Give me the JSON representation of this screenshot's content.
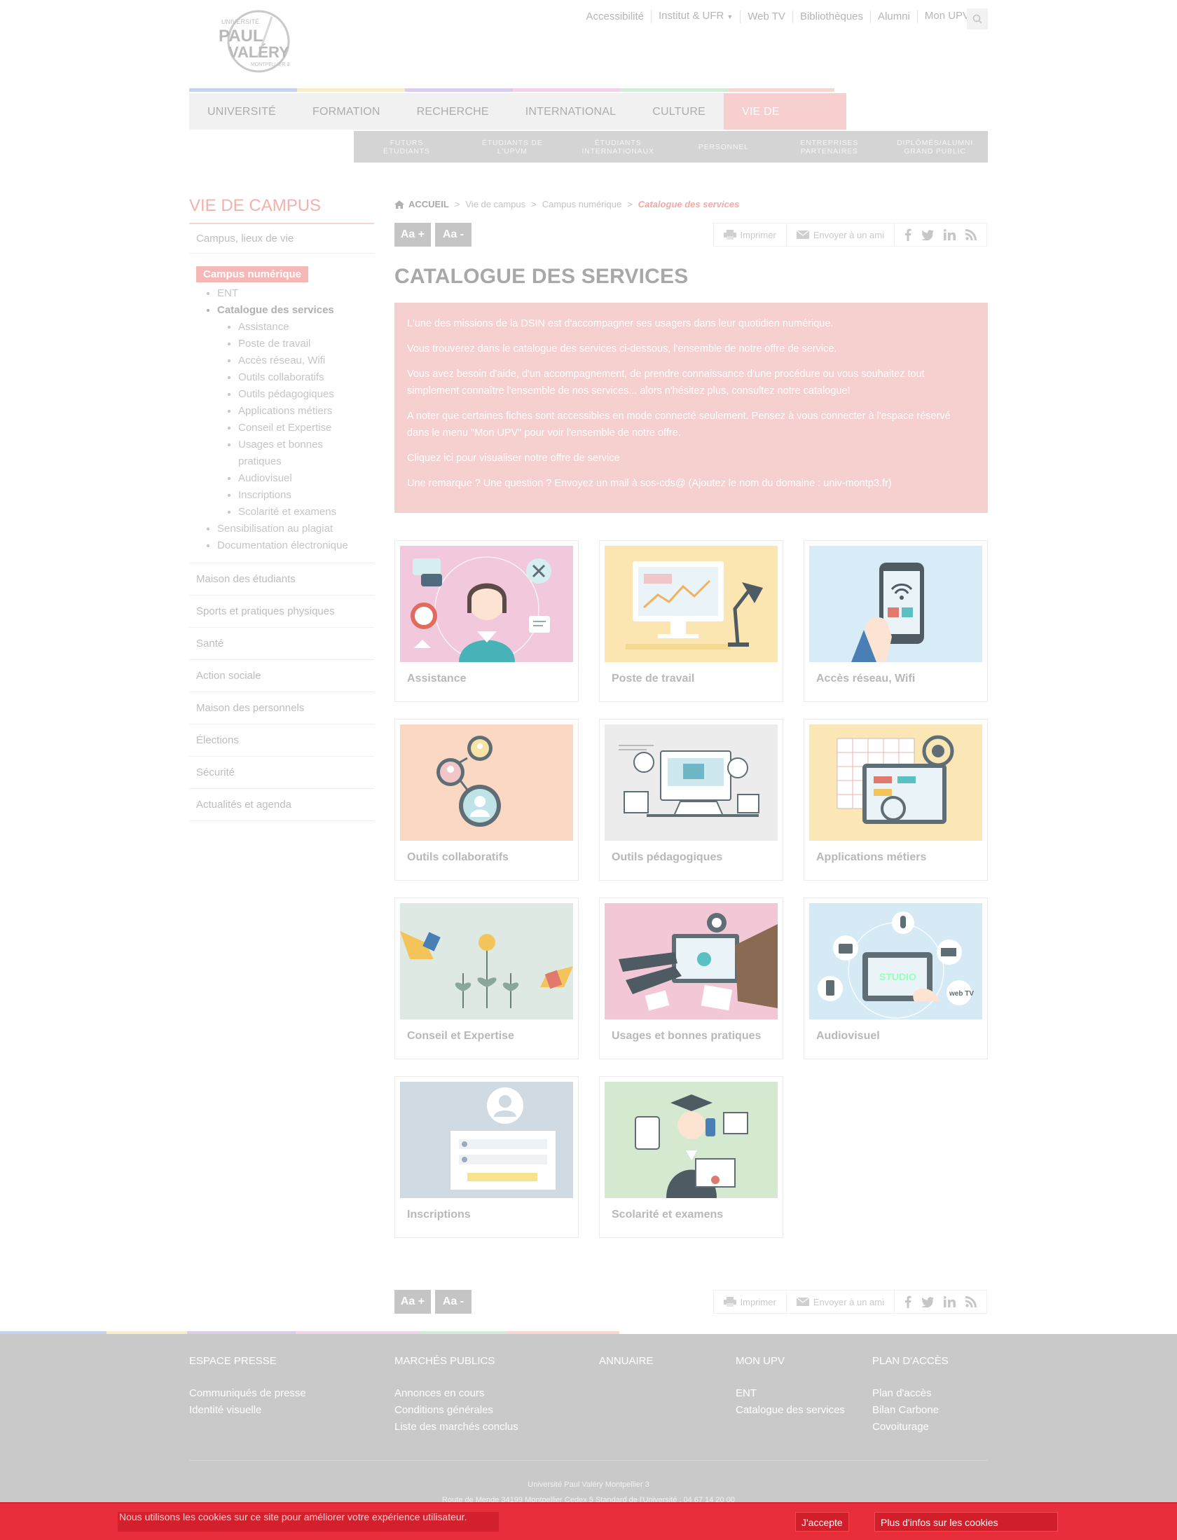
{
  "header": {
    "logo": {
      "line1": "UNIVERSITÉ",
      "line2": "PAUL",
      "line3": "VALÉRY",
      "line4": "MONTPELLIER 3"
    },
    "topnav": [
      {
        "label": "Accessibilité",
        "caret": false
      },
      {
        "label": "Institut & UFR",
        "caret": true
      },
      {
        "label": "Web TV",
        "caret": false
      },
      {
        "label": "Bibliothèques",
        "caret": false
      },
      {
        "label": "Alumni",
        "caret": false
      },
      {
        "label": "Mon UPV",
        "caret": true
      }
    ],
    "mainnav": [
      "Université",
      "Formation",
      "Recherche",
      "International",
      "Culture",
      "Vie de campus"
    ],
    "mainnav_active": "Vie de campus",
    "subnav": [
      {
        "l1": "Futurs",
        "l2": "étudiants"
      },
      {
        "l1": "Étudiants de",
        "l2": "l'UPVM"
      },
      {
        "l1": "Étudiants",
        "l2": "internationaux"
      },
      {
        "l1": "Personnel",
        "l2": ""
      },
      {
        "l1": "Entreprises",
        "l2": "partenaires"
      },
      {
        "l1": "Diplômés/Alumni",
        "l2": "Grand public"
      }
    ],
    "colors": {
      "accent": "#f7cfcf",
      "bar": [
        "#c6d3ec",
        "#f7edc8",
        "#d9cdec",
        "#f3d3e7",
        "#d1ecd8",
        "#f6d7d2"
      ]
    }
  },
  "sidebar": {
    "title": "VIE DE CAMPUS",
    "link_first": "Campus, lieux de vie",
    "active": "Campus numérique",
    "tree": {
      "items_top": [
        "ENT"
      ],
      "current": "Catalogue des services",
      "children": [
        "Assistance",
        "Poste de travail",
        "Accès réseau, Wifi",
        "Outils collaboratifs",
        "Outils pédagogiques",
        "Applications métiers",
        "Conseil et Expertise",
        "Usages et bonnes pratiques",
        "Audiovisuel",
        "Inscriptions",
        "Scolarité et examens"
      ],
      "items_bottom": [
        "Sensibilisation au plagiat",
        "Documentation électronique"
      ]
    },
    "links": [
      "Maison des étudiants",
      "Sports et pratiques physiques",
      "Santé",
      "Action sociale",
      "Maison des personnels",
      "Élections",
      "Sécurité",
      "Actualités et agenda"
    ]
  },
  "breadcrumb": {
    "home": "ACCUEIL",
    "items": [
      "Vie de campus",
      "Campus numérique"
    ],
    "current": "Catalogue des services"
  },
  "toolbar": {
    "font_plus": "Aa +",
    "font_minus": "Aa -",
    "print": "Imprimer",
    "send": "Envoyer à un ami"
  },
  "page_title": "CATALOGUE DES SERVICES",
  "intro": [
    "L'une des missions de la DSIN est d'accompagner ses usagers dans leur quotidien numérique.",
    "Vous trouverez dans le catalogue des services ci-dessous, l'ensemble de notre offre de service.",
    "Vous avez besoin d'aide, d'un accompagnement, de prendre connaissance d'une procédure ou vous souhaitez tout simplement connaître l'ensemble de nos services... alors n'hésitez plus, consultez notre catalogue!",
    "A noter que certaines fiches sont accessibles en mode connecté seulement. Pensez à vous connecter à l'espace réservé dans le menu \"Mon UPV\" pour voir l'ensemble de notre offre.",
    "Cliquez ici pour visualiser notre offre de service",
    "Une remarque ? Une question ? Envoyez un mail à sos-cds@ (Ajoutez le nom du domaine : univ-montp3.fr)"
  ],
  "cards": [
    {
      "label": "Assistance",
      "bg": "#f2c9dc",
      "icon": "assistance-illustration"
    },
    {
      "label": "Poste de travail",
      "bg": "#fbe6b2",
      "icon": "workstation-illustration"
    },
    {
      "label": "Accès réseau, Wifi",
      "bg": "#d8ecf7",
      "icon": "wifi-phone-illustration"
    },
    {
      "label": "Outils collaboratifs",
      "bg": "#fbd8c3",
      "icon": "collaboration-illustration"
    },
    {
      "label": "Outils pédagogiques",
      "bg": "#ececec",
      "icon": "pedagogy-illustration"
    },
    {
      "label": "Applications métiers",
      "bg": "#fbe6b6",
      "icon": "apps-illustration"
    },
    {
      "label": "Conseil et Expertise",
      "bg": "#dfe9e3",
      "icon": "advice-illustration"
    },
    {
      "label": "Usages et bonnes pratiques",
      "bg": "#f2c7d6",
      "icon": "practices-illustration"
    },
    {
      "label": "Audiovisuel",
      "bg": "#d6eaf6",
      "icon": "audiovisual-illustration"
    },
    {
      "label": "Inscriptions",
      "bg": "#cfdae3",
      "icon": "registration-illustration"
    },
    {
      "label": "Scolarité et examens",
      "bg": "#d4e9cf",
      "icon": "exams-illustration"
    }
  ],
  "card_texts": {
    "studio": "STUDIO",
    "webtv": "web TV"
  },
  "footer": {
    "columns": [
      {
        "title": "ESPACE PRESSE",
        "links": [
          "Communiqués de presse",
          "Identité visuelle"
        ]
      },
      {
        "title": "MARCHÉS PUBLICS",
        "links": [
          "Annonces en cours",
          "Conditions générales",
          "Liste des marchés conclus"
        ]
      },
      {
        "title": "ANNUAIRE",
        "links": []
      },
      {
        "title": "MON UPV",
        "links": [
          "ENT",
          "Catalogue des services"
        ]
      },
      {
        "title": "PLAN D'ACCÈS",
        "links": [
          "Plan d'accès",
          "Bilan Carbone",
          "Covoiturage"
        ]
      }
    ],
    "address_line1": "Université Paul Valéry Montpellier 3",
    "address_line2": "Route de Mende 34199 Montpellier Cedex 5 Standard de l'Université : 04 67 14 20 00"
  },
  "cookie": {
    "text": "Nous utilisons les cookies sur ce site pour améliorer votre expérience utilisateur.",
    "accept": "J'accepte",
    "more": "Plus d'infos sur les cookies"
  }
}
